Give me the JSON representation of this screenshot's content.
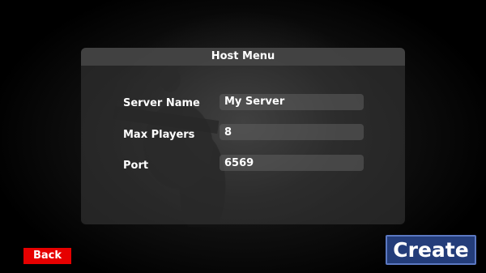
{
  "host_menu": {
    "title": "Host Menu",
    "server_name": {
      "label": "Server Name",
      "value": "My Server"
    },
    "max_players": {
      "label": "Max Players",
      "value": "8"
    },
    "port": {
      "label": "Port",
      "value": "6569"
    }
  },
  "actions": {
    "back_label": "Back",
    "create_label": "Create"
  }
}
